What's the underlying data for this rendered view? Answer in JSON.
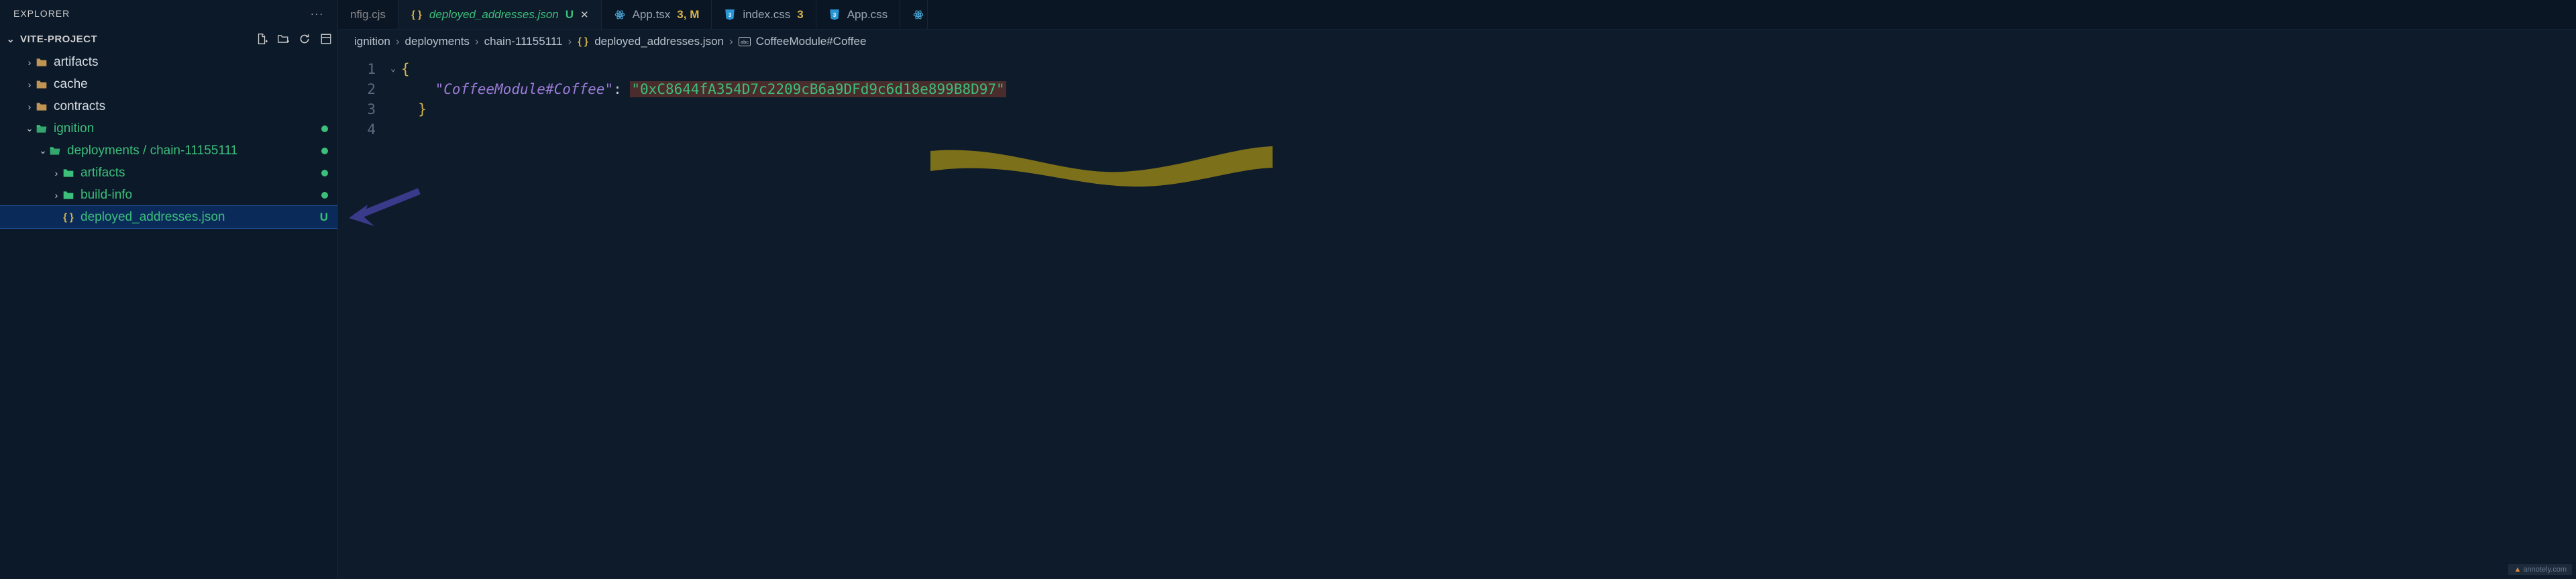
{
  "explorer": {
    "title": "EXPLORER",
    "project": "VITE-PROJECT",
    "tree": [
      {
        "kind": "folder",
        "open": false,
        "depth": 1,
        "label": "artifacts",
        "tone": "white",
        "status": ""
      },
      {
        "kind": "folder",
        "open": false,
        "depth": 1,
        "label": "cache",
        "tone": "white",
        "status": ""
      },
      {
        "kind": "folder",
        "open": false,
        "depth": 1,
        "label": "contracts",
        "tone": "white",
        "status": ""
      },
      {
        "kind": "folder",
        "open": true,
        "depth": 1,
        "label": "ignition",
        "tone": "green",
        "status": "dot"
      },
      {
        "kind": "folder",
        "open": true,
        "depth": 2,
        "label": "deployments / chain-11155111",
        "tone": "green",
        "status": "dot"
      },
      {
        "kind": "folder",
        "open": false,
        "depth": 3,
        "label": "artifacts",
        "tone": "green",
        "status": "dot"
      },
      {
        "kind": "folder",
        "open": false,
        "depth": 3,
        "label": "build-info",
        "tone": "green",
        "status": "dot"
      },
      {
        "kind": "file",
        "open": false,
        "depth": 3,
        "label": "deployed_addresses.json",
        "tone": "green",
        "status": "U",
        "selected": true,
        "icon": "json"
      }
    ]
  },
  "tabs": [
    {
      "icon": "",
      "label": "nfig.cjs",
      "partial": true
    },
    {
      "icon": "json",
      "label": "deployed_addresses.json",
      "italic": true,
      "badge": "U",
      "badgeClass": "u-badge",
      "active": true,
      "close": true
    },
    {
      "icon": "react",
      "label": "App.tsx",
      "badge": "3, M",
      "badgeClass": "mod-badge"
    },
    {
      "icon": "css",
      "label": "index.css",
      "badge": "3",
      "badgeClass": "mod-badge"
    },
    {
      "icon": "css",
      "label": "App.css"
    }
  ],
  "breadcrumb": {
    "parts": [
      {
        "text": "ignition"
      },
      {
        "text": "deployments"
      },
      {
        "text": "chain-11155111"
      },
      {
        "icon": "json",
        "text": "deployed_addresses.json"
      },
      {
        "icon": "abc",
        "text": "CoffeeModule#Coffee"
      }
    ]
  },
  "code": {
    "lines": [
      "1",
      "2",
      "3",
      "4"
    ],
    "l1": "{",
    "key": "\"CoffeeModule#Coffee\"",
    "colon": ": ",
    "val": "\"0xC8644fA354D7c2209cB6a9DFd9c6d18e899B8D97\"",
    "l3": "}"
  },
  "watermark": "annotely.com"
}
